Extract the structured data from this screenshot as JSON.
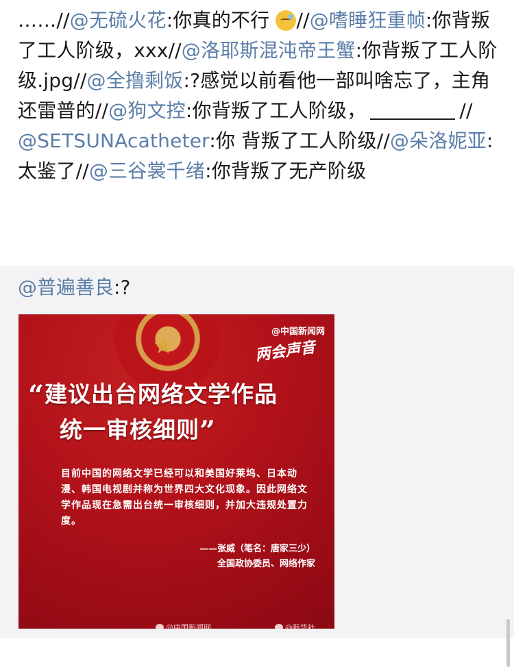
{
  "repost": {
    "t0": "……//",
    "m1": "@无硫火花",
    "t1": ":你真的不行",
    "t2": "//",
    "m2": "@嗜睡狂重帧",
    "t3": ":你背叛了工人阶级，xxx//",
    "m3": "@洛耶斯混沌帝王蟹",
    "t4": ":你背叛了工人阶级.jpg//",
    "m4": "@全撸剩饭",
    "t5": ":?感觉以前看他一部叫啥忘了，主角还雷普的//",
    "m5": "@狗文控",
    "t6": ":你背叛了工人阶级，",
    "t7": "//",
    "m6": "@SETSUNAcatheter",
    "t8": ":你 背叛了工人阶级//",
    "m7": "@朵洛妮亚",
    "t9": ":太鉴了//",
    "m8": "@三谷裳千绪",
    "t10": ":你背叛了无产阶级"
  },
  "reply": {
    "mention": "@普遍善良",
    "text": ":?"
  },
  "poster": {
    "logo": "@中国新闻网",
    "tag": "两会声音",
    "title_line1": "建议出台网络文学作品",
    "title_line2": "统一审核细则",
    "open_quote": "“",
    "close_quote": "”",
    "body": "目前中国的网络文学已经可以和美国好莱坞、日本动漫、韩国电视剧并称为世界四大文化现象。因此网络文学作品现在急需出台统一审核细则，并加大违规处置力度。",
    "sign_line1": "——张威（笔名：唐家三少）",
    "sign_line2": "全国政协委员、网络作家",
    "footer_left": "@中国新闻网",
    "footer_right": "@新华社"
  },
  "colors": {
    "mention": "#5b7ea8",
    "poster_red": "#b3121a",
    "background": "#f3f3f5"
  }
}
